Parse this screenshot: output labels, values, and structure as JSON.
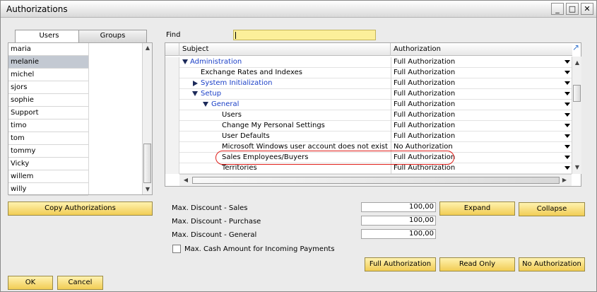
{
  "window": {
    "title": "Authorizations"
  },
  "titlebar_buttons": {
    "minimize": "_",
    "maximize": "□",
    "close": "✕"
  },
  "tabs": [
    {
      "label": "Users"
    },
    {
      "label": "Groups"
    }
  ],
  "users": [
    "maria",
    "melanie",
    "michel",
    "sjors",
    "sophie",
    "Support",
    "timo",
    "tom",
    "tommy",
    "Vicky",
    "willem",
    "willy"
  ],
  "copy_button": "Copy Authorizations",
  "find": {
    "label": "Find",
    "value": ""
  },
  "grid": {
    "headers": {
      "subject": "Subject",
      "authorization": "Authorization"
    },
    "rows": [
      {
        "subject": "Administration",
        "authorization": "Full Authorization"
      },
      {
        "subject": "Exchange Rates and Indexes",
        "authorization": "Full Authorization"
      },
      {
        "subject": "System Initialization",
        "authorization": "Full Authorization"
      },
      {
        "subject": "Setup",
        "authorization": "Full Authorization"
      },
      {
        "subject": "General",
        "authorization": "Full Authorization"
      },
      {
        "subject": "Users",
        "authorization": "Full Authorization"
      },
      {
        "subject": "Change My Personal Settings",
        "authorization": "Full Authorization"
      },
      {
        "subject": "User Defaults",
        "authorization": "Full Authorization"
      },
      {
        "subject": "Microsoft Windows user account does not exist",
        "authorization": "No Authorization"
      },
      {
        "subject": "Sales Employees/Buyers",
        "authorization": "Full Authorization"
      },
      {
        "subject": "Territories",
        "authorization": "Full Authorization"
      }
    ]
  },
  "discounts": {
    "sales": {
      "label": "Max. Discount - Sales",
      "value": "100,00"
    },
    "purchase": {
      "label": "Max. Discount - Purchase",
      "value": "100,00"
    },
    "general": {
      "label": "Max. Discount - General",
      "value": "100,00"
    }
  },
  "cash_checkbox": {
    "label": "Max. Cash Amount for Incoming Payments"
  },
  "buttons": {
    "expand": "Expand",
    "collapse": "Collapse",
    "full_authorization": "Full Authorization",
    "read_only": "Read Only",
    "no_authorization": "No Authorization",
    "ok": "OK",
    "cancel": "Cancel"
  },
  "colors": {
    "button_yellow": "#f1cd54",
    "find_yellow": "#fcef9a",
    "link_blue": "#1a3fc7",
    "highlight_red": "#e0201b",
    "selected_row": "#c3c9d2"
  }
}
